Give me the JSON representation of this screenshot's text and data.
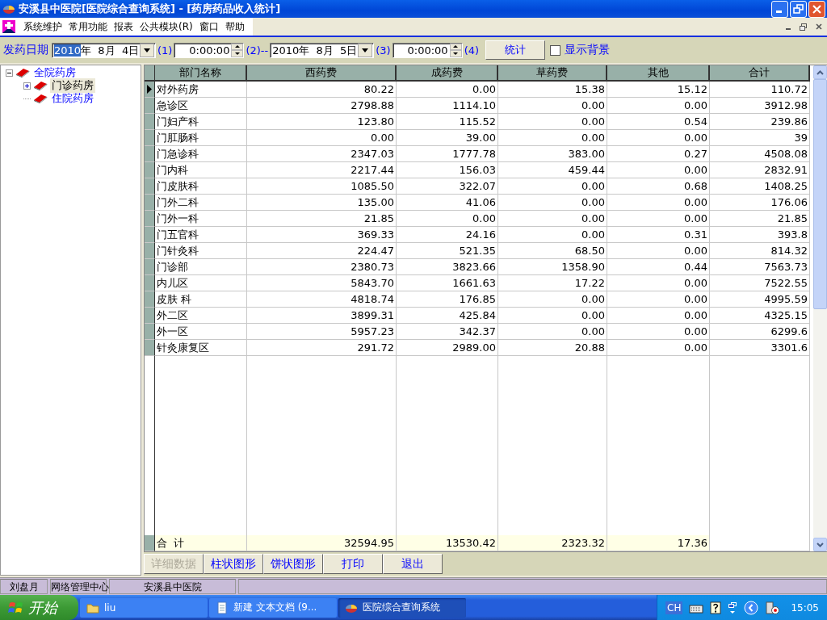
{
  "window": {
    "title": "安溪县中医院[医院综合查询系统] - [药房药品收入统计]"
  },
  "menu": [
    "系统维护",
    "常用功能",
    "报表",
    "公共模块(R)",
    "窗口",
    "帮助"
  ],
  "toolbar": {
    "date_label": "发药日期",
    "start_date": {
      "selected_text": "2010",
      "text": "年  8月  4日"
    },
    "marker_1": "(1)",
    "start_time": "0:00:00",
    "marker_2": "(2)--",
    "end_date": {
      "text": "2010年  8月  5日"
    },
    "marker_3": "(3)",
    "end_time": "0:00:00",
    "marker_4": "(4)",
    "stat_button": "统计",
    "show_background": {
      "label": "显示背景",
      "checked": false
    }
  },
  "tree": [
    {
      "label": "全院药房",
      "kind": "branch",
      "expanded": true,
      "selected": false,
      "children": [
        {
          "label": "门诊药房",
          "kind": "branch",
          "expanded": false,
          "selected": true
        },
        {
          "label": "住院药房",
          "kind": "leaf",
          "selected": false
        }
      ]
    }
  ],
  "table": {
    "columns": [
      "部门名称",
      "西药费",
      "成药费",
      "草药费",
      "其他",
      "合计"
    ],
    "rows": [
      {
        "current": true,
        "cells": [
          "对外药房",
          "80.22",
          "0.00",
          "15.38",
          "15.12",
          "110.72"
        ]
      },
      {
        "current": false,
        "cells": [
          "急诊区",
          "2798.88",
          "1114.10",
          "0.00",
          "0.00",
          "3912.98"
        ]
      },
      {
        "current": false,
        "cells": [
          "门妇产科",
          "123.80",
          "115.52",
          "0.00",
          "0.54",
          "239.86"
        ]
      },
      {
        "current": false,
        "cells": [
          "门肛肠科",
          "0.00",
          "39.00",
          "0.00",
          "0.00",
          "39"
        ]
      },
      {
        "current": false,
        "cells": [
          "门急诊科",
          "2347.03",
          "1777.78",
          "383.00",
          "0.27",
          "4508.08"
        ]
      },
      {
        "current": false,
        "cells": [
          "门内科",
          "2217.44",
          "156.03",
          "459.44",
          "0.00",
          "2832.91"
        ]
      },
      {
        "current": false,
        "cells": [
          "门皮肤科",
          "1085.50",
          "322.07",
          "0.00",
          "0.68",
          "1408.25"
        ]
      },
      {
        "current": false,
        "cells": [
          "门外二科",
          "135.00",
          "41.06",
          "0.00",
          "0.00",
          "176.06"
        ]
      },
      {
        "current": false,
        "cells": [
          "门外一科",
          "21.85",
          "0.00",
          "0.00",
          "0.00",
          "21.85"
        ]
      },
      {
        "current": false,
        "cells": [
          "门五官科",
          "369.33",
          "24.16",
          "0.00",
          "0.31",
          "393.8"
        ]
      },
      {
        "current": false,
        "cells": [
          "门针灸科",
          "224.47",
          "521.35",
          "68.50",
          "0.00",
          "814.32"
        ]
      },
      {
        "current": false,
        "cells": [
          "门诊部",
          "2380.73",
          "3823.66",
          "1358.90",
          "0.44",
          "7563.73"
        ]
      },
      {
        "current": false,
        "cells": [
          "内儿区",
          "5843.70",
          "1661.63",
          "17.22",
          "0.00",
          "7522.55"
        ]
      },
      {
        "current": false,
        "cells": [
          "皮肤 科",
          "4818.74",
          "176.85",
          "0.00",
          "0.00",
          "4995.59"
        ]
      },
      {
        "current": false,
        "cells": [
          "外二区",
          "3899.31",
          "425.84",
          "0.00",
          "0.00",
          "4325.15"
        ]
      },
      {
        "current": false,
        "cells": [
          "外一区",
          "5957.23",
          "342.37",
          "0.00",
          "0.00",
          "6299.6"
        ]
      },
      {
        "current": false,
        "cells": [
          "针灸康复区",
          "291.72",
          "2989.00",
          "20.88",
          "0.00",
          "3301.6"
        ]
      }
    ],
    "total": [
      "合  计",
      "32594.95",
      "13530.42",
      "2323.32",
      "17.36"
    ]
  },
  "buttons": [
    {
      "label": "详细数据",
      "disabled": true
    },
    {
      "label": "柱状图形",
      "disabled": false
    },
    {
      "label": "饼状图形",
      "disabled": false
    },
    {
      "label": "打印",
      "disabled": false
    },
    {
      "label": "退出",
      "disabled": false
    }
  ],
  "status_bar": [
    "刘盘月",
    "网络管理中心",
    "安溪县中医院"
  ],
  "taskbar": {
    "start": "开始",
    "tasks": [
      {
        "label": "liu",
        "selected": false
      },
      {
        "label": "新建 文本文档 (9...",
        "selected": false
      },
      {
        "label": "医院综合查询系统",
        "selected": true
      }
    ],
    "language": "CH",
    "clock": "15:05"
  }
}
